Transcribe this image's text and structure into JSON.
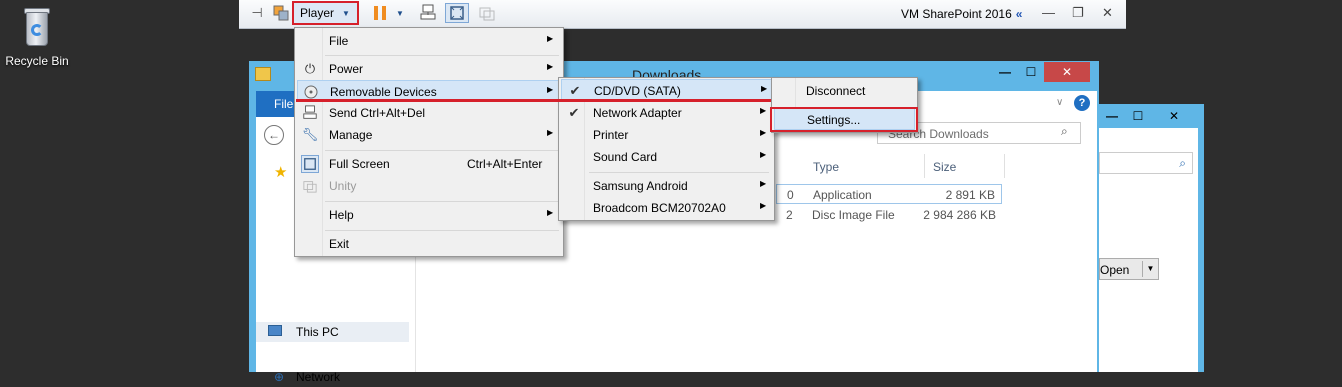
{
  "desktop": {
    "recycle_bin_label": "Recycle Bin"
  },
  "vm_toolbar": {
    "player_label": "Player",
    "vm_name": "VM SharePoint 2016",
    "collapse_glyph": "«"
  },
  "explorer": {
    "title": "Downloads",
    "file_tab": "File",
    "search_placeholder": "Search Downloads",
    "columns": {
      "type": "Type",
      "size": "Size"
    },
    "rows": [
      {
        "date_fragment": "0",
        "type": "Application",
        "size": "2 891 KB"
      },
      {
        "date_fragment": "2",
        "type": "Disc Image File",
        "size": "2 984 286 KB"
      }
    ],
    "nav": {
      "this_pc": "This PC",
      "network": "Network"
    }
  },
  "second_window": {
    "open_button": "Open"
  },
  "player_menu": {
    "items": [
      {
        "label": "File"
      },
      {
        "label": "Power"
      },
      {
        "label": "Removable Devices"
      },
      {
        "label": "Send Ctrl+Alt+Del"
      },
      {
        "label": "Manage"
      },
      {
        "label": "Full Screen",
        "shortcut": "Ctrl+Alt+Enter"
      },
      {
        "label": "Unity"
      },
      {
        "label": "Help"
      },
      {
        "label": "Exit"
      }
    ]
  },
  "devices_menu": {
    "items": [
      {
        "label": "CD/DVD (SATA)"
      },
      {
        "label": "Network Adapter"
      },
      {
        "label": "Printer"
      },
      {
        "label": "Sound Card"
      },
      {
        "label": "Samsung Android"
      },
      {
        "label": "Broadcom BCM20702A0"
      }
    ]
  },
  "cd_menu": {
    "items": [
      {
        "label": "Disconnect"
      },
      {
        "label": "Settings..."
      }
    ]
  },
  "colors": {
    "highlight_red": "#d6202b",
    "menu_highlight": "#d5e6f7",
    "window_frame": "#5fb6e6"
  }
}
